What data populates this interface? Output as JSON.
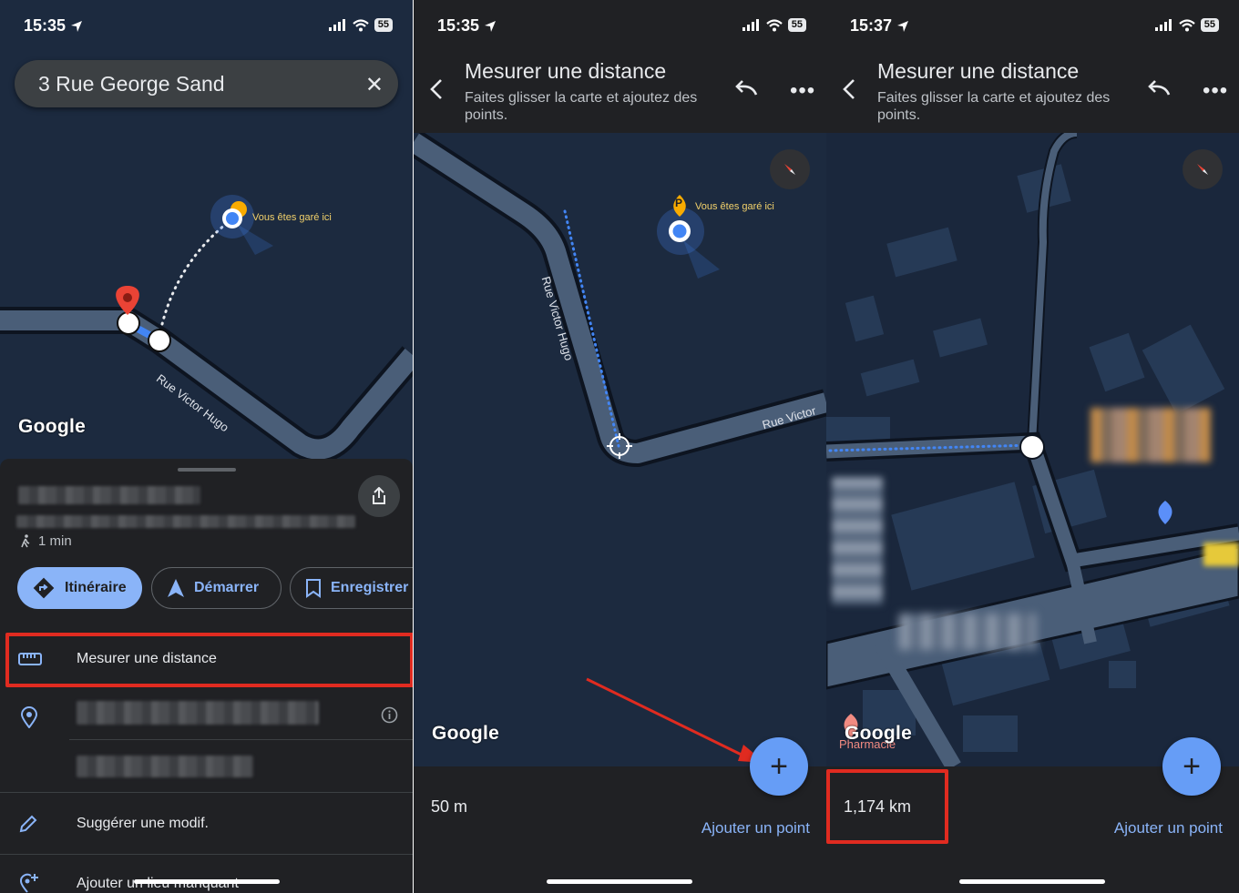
{
  "panel1": {
    "status": {
      "time": "15:35",
      "battery": "55"
    },
    "search": {
      "query": "3 Rue George Sand",
      "clear_icon": "close-icon"
    },
    "map": {
      "parked_label": "Vous êtes garé ici",
      "street_label": "Rue Victor Hugo",
      "logo": "Google"
    },
    "sheet": {
      "walk_time": "1 min",
      "chips": [
        {
          "label": "Itinéraire",
          "icon": "directions-icon"
        },
        {
          "label": "Démarrer",
          "icon": "navigation-arrow-icon"
        },
        {
          "label": "Enregistrer",
          "icon": "bookmark-icon"
        }
      ],
      "measure_label": "Mesurer une distance",
      "suggest_label": "Suggérer une modif.",
      "add_place_label": "Ajouter un lieu manquant"
    }
  },
  "panel2": {
    "status": {
      "time": "15:35",
      "battery": "55"
    },
    "topbar": {
      "title": "Mesurer une distance",
      "subtitle": "Faites glisser la carte et ajoutez des points."
    },
    "map": {
      "parked_label": "Vous êtes garé ici",
      "parking_letter": "P",
      "street_label_1": "Rue Victor Hugo",
      "street_label_2": "Rue Victor",
      "logo": "Google"
    },
    "bottom": {
      "distance": "50 m",
      "add_point": "Ajouter un point"
    }
  },
  "panel3": {
    "status": {
      "time": "15:37",
      "battery": "55"
    },
    "topbar": {
      "title": "Mesurer une distance",
      "subtitle": "Faites glisser la carte et ajoutez des points."
    },
    "map": {
      "logo": "Google",
      "poi_label": "Pharmacie"
    },
    "bottom": {
      "distance": "1,174 km",
      "add_point": "Ajouter un point"
    }
  },
  "colors": {
    "map_bg": "#1c2a3f",
    "road": "#4a5e78",
    "accent_blue": "#8ab4f8",
    "fab_blue": "#669df6",
    "highlight_red": "#e02b20",
    "marker_red": "#ea4335",
    "parking_yellow": "#f9ab00"
  }
}
